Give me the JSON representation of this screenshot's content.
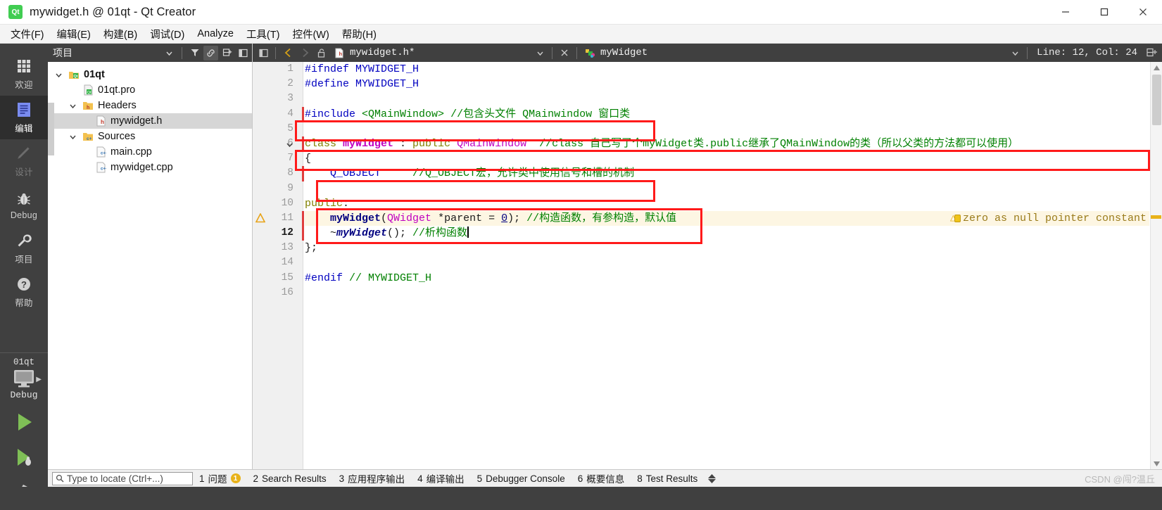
{
  "window": {
    "title": "mywidget.h @ 01qt - Qt Creator",
    "logo_icon": "qt-logo-icon",
    "minimize_icon": "minimize-icon",
    "maximize_icon": "maximize-icon",
    "close_icon": "close-icon"
  },
  "menubar": {
    "items": [
      {
        "label": "文件(F)",
        "mnemonic": "F"
      },
      {
        "label": "编辑(E)",
        "mnemonic": "E"
      },
      {
        "label": "构建(B)",
        "mnemonic": "B"
      },
      {
        "label": "调试(D)",
        "mnemonic": "D"
      },
      {
        "label": "Analyze",
        "mnemonic": "A"
      },
      {
        "label": "工具(T)",
        "mnemonic": "T"
      },
      {
        "label": "控件(W)",
        "mnemonic": "W"
      },
      {
        "label": "帮助(H)",
        "mnemonic": "H"
      }
    ]
  },
  "modebar": {
    "modes": [
      {
        "label": "欢迎",
        "icon": "grid-icon",
        "state": "normal"
      },
      {
        "label": "编辑",
        "icon": "document-lines-icon",
        "state": "active"
      },
      {
        "label": "设计",
        "icon": "pencil-icon",
        "state": "disabled"
      },
      {
        "label": "Debug",
        "icon": "bug-icon",
        "state": "normal"
      },
      {
        "label": "项目",
        "icon": "wrench-icon",
        "state": "normal"
      },
      {
        "label": "帮助",
        "icon": "question-circle-icon",
        "state": "normal"
      }
    ],
    "kit": {
      "project_name": "01qt",
      "monitor_icon": "desktop-monitor-icon",
      "build_config": "Debug",
      "run_icon": "run-play-icon",
      "debug_icon": "debug-play-icon",
      "build_icon": "hammer-icon"
    }
  },
  "project_pane": {
    "title": "项目",
    "header_buttons": [
      {
        "icon": "chevron-down-icon",
        "name": "view-selector"
      },
      {
        "icon": "filter-icon",
        "name": "filter-tree"
      },
      {
        "icon": "link-icon",
        "name": "synchronize-with-editor",
        "active": true
      },
      {
        "icon": "collapse-all-icon",
        "name": "collapse-all"
      },
      {
        "icon": "hide-sidebar-icon",
        "name": "close-sidebar"
      }
    ],
    "tree": [
      {
        "label": "01qt",
        "icon": "qt-project-icon",
        "depth": 0,
        "expanded": true,
        "bold": true,
        "selected": false
      },
      {
        "label": "01qt.pro",
        "icon": "pro-file-icon",
        "depth": 1,
        "expanded": null,
        "bold": false,
        "selected": false
      },
      {
        "label": "Headers",
        "icon": "folder-h-icon",
        "depth": 1,
        "expanded": true,
        "bold": false,
        "selected": false
      },
      {
        "label": "mywidget.h",
        "icon": "header-file-icon",
        "depth": 2,
        "expanded": null,
        "bold": false,
        "selected": true
      },
      {
        "label": "Sources",
        "icon": "folder-cpp-icon",
        "depth": 1,
        "expanded": true,
        "bold": false,
        "selected": false
      },
      {
        "label": "main.cpp",
        "icon": "cpp-file-icon",
        "depth": 2,
        "expanded": null,
        "bold": false,
        "selected": false
      },
      {
        "label": "mywidget.cpp",
        "icon": "cpp-file-icon",
        "depth": 2,
        "expanded": null,
        "bold": false,
        "selected": false
      }
    ]
  },
  "editor": {
    "toolbar": {
      "sidebar_toggle_icon": "show-sidebar-icon",
      "back_icon": "back-arrow-icon",
      "forward_icon": "forward-arrow-icon",
      "lock_icon": "unlocked-icon",
      "file_icon": "header-file-icon",
      "filename": "mywidget.h*",
      "dropdown_icon": "chevron-down-icon",
      "close_icon": "close-x-icon",
      "symbol_icon": "class-symbol-icon",
      "symbol": "myWidget",
      "symbol_dropdown_icon": "chevron-down-icon",
      "line_col": "Line: 12, Col: 24",
      "split_icon": "split-editor-icon"
    },
    "lines": [
      {
        "n": "1",
        "tokens": [
          {
            "t": "#ifndef ",
            "c": "pp"
          },
          {
            "t": "MYWIDGET_H",
            "c": "pp"
          }
        ]
      },
      {
        "n": "2",
        "tokens": [
          {
            "t": "#define ",
            "c": "pp"
          },
          {
            "t": "MYWIDGET_H",
            "c": "pp"
          }
        ]
      },
      {
        "n": "3",
        "tokens": []
      },
      {
        "n": "4",
        "tokens": [
          {
            "t": "#include ",
            "c": "pp"
          },
          {
            "t": "<QMainWindow>",
            "c": "cm"
          },
          {
            "t": " ",
            "c": "op"
          },
          {
            "t": "//包含头文件 QMainwindow 窗口类",
            "c": "cm"
          }
        ]
      },
      {
        "n": "5",
        "tokens": []
      },
      {
        "n": "6",
        "tokens": [
          {
            "t": "class ",
            "c": "kw"
          },
          {
            "t": "myWidget",
            "c": "cls"
          },
          {
            "t": " : ",
            "c": "op"
          },
          {
            "t": "public ",
            "c": "kw"
          },
          {
            "t": "QMainWindow",
            "c": "type"
          },
          {
            "t": "  ",
            "c": "op"
          },
          {
            "t": "//class 自己写了个myWidget类.public继承了QMainWindow的类（所以父类的方法都可以使用）",
            "c": "cm"
          }
        ]
      },
      {
        "n": "7",
        "tokens": [
          {
            "t": "{",
            "c": "op"
          }
        ]
      },
      {
        "n": "8",
        "tokens": [
          {
            "t": "    ",
            "c": "op"
          },
          {
            "t": "Q_OBJECT",
            "c": "mac"
          },
          {
            "t": "     ",
            "c": "op"
          },
          {
            "t": "//Q_OBJECT宏，允许类中使用信号和槽的机制",
            "c": "cm"
          }
        ]
      },
      {
        "n": "9",
        "tokens": []
      },
      {
        "n": "10",
        "tokens": [
          {
            "t": "public",
            "c": "kw"
          },
          {
            "t": ":",
            "c": "op"
          }
        ]
      },
      {
        "n": "11",
        "tokens": [
          {
            "t": "    ",
            "c": "op"
          },
          {
            "t": "myWidget",
            "c": "fn"
          },
          {
            "t": "(",
            "c": "op"
          },
          {
            "t": "QWidget",
            "c": "type"
          },
          {
            "t": " *parent = ",
            "c": "op"
          },
          {
            "t": "0",
            "c": "num"
          },
          {
            "t": "); ",
            "c": "op"
          },
          {
            "t": "//构造函数，有参构造，默认值",
            "c": "cm"
          }
        ]
      },
      {
        "n": "12",
        "tokens": [
          {
            "t": "    ~",
            "c": "op"
          },
          {
            "t": "myWidget",
            "c": "dtor"
          },
          {
            "t": "(); ",
            "c": "op"
          },
          {
            "t": "//析构函数",
            "c": "cm"
          }
        ]
      },
      {
        "n": "13",
        "tokens": [
          {
            "t": "};",
            "c": "op"
          }
        ]
      },
      {
        "n": "14",
        "tokens": []
      },
      {
        "n": "15",
        "tokens": [
          {
            "t": "#endif ",
            "c": "pp"
          },
          {
            "t": "// MYWIDGET_H",
            "c": "cm"
          }
        ]
      },
      {
        "n": "16",
        "tokens": []
      }
    ],
    "current_line": "12",
    "warning_line": "11",
    "warning_icon": "warning-triangle-icon",
    "warning_text": "zero as null pointer constant",
    "annotations": [
      {
        "name": "annotation-include-line",
        "target_line": "4"
      },
      {
        "name": "annotation-class-decl-line",
        "target_line": "6"
      },
      {
        "name": "annotation-qobject-macro",
        "target_line": "8"
      },
      {
        "name": "annotation-constructor-destructor",
        "target_line": "11-12"
      }
    ],
    "annotation_color": "#ff1a1a"
  },
  "bottombar": {
    "locator": {
      "icon": "search-icon",
      "placeholder": "Type to locate (Ctrl+...)"
    },
    "panes": [
      {
        "num": "1",
        "label": "问题",
        "badge": "1"
      },
      {
        "num": "2",
        "label": "Search Results",
        "badge": ""
      },
      {
        "num": "3",
        "label": "应用程序输出",
        "badge": ""
      },
      {
        "num": "4",
        "label": "编译输出",
        "badge": ""
      },
      {
        "num": "5",
        "label": "Debugger Console",
        "badge": ""
      },
      {
        "num": "6",
        "label": "概要信息",
        "badge": ""
      },
      {
        "num": "8",
        "label": "Test Results",
        "badge": ""
      }
    ],
    "updown_icon": "up-down-arrows-icon",
    "watermark": "CSDN @闯?温丘"
  }
}
